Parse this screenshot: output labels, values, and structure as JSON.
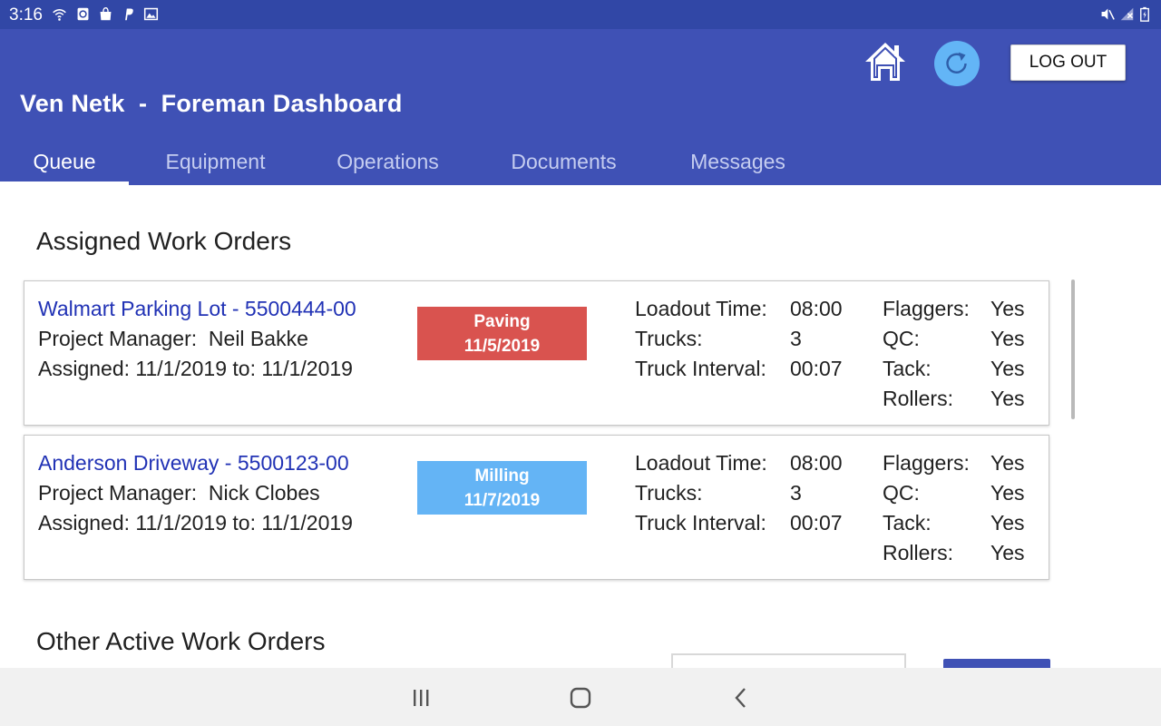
{
  "status_bar": {
    "time": "3:16",
    "left_icons": [
      "wifi-icon",
      "notification-app-icon",
      "shopping-bag-icon",
      "paypal-icon",
      "image-icon"
    ],
    "right_icons": [
      "mute-icon",
      "no-signal-icon",
      "battery-charging-icon"
    ]
  },
  "header": {
    "title": "Ven Netk  -  Foreman Dashboard",
    "logout_label": "LOG OUT"
  },
  "tabs": [
    {
      "label": "Queue",
      "active": true
    },
    {
      "label": "Equipment",
      "active": false
    },
    {
      "label": "Operations",
      "active": false
    },
    {
      "label": "Documents",
      "active": false
    },
    {
      "label": "Messages",
      "active": false
    }
  ],
  "assigned": {
    "title": "Assigned Work Orders",
    "orders": [
      {
        "name": "Walmart Parking Lot - 5500444-00",
        "pm_label": "Project Manager:",
        "pm_name": "Neil Bakke",
        "assigned_text": "Assigned: 11/1/2019 to: 11/1/2019",
        "badge_type": "Paving",
        "badge_date": "11/5/2019",
        "badge_color": "#d9534f",
        "loadout_label": "Loadout Time:",
        "loadout_value": "08:00",
        "trucks_label": "Trucks:",
        "trucks_value": "3",
        "interval_label": "Truck Interval:",
        "interval_value": "00:07",
        "flaggers_label": "Flaggers:",
        "flaggers_value": "Yes",
        "qc_label": "QC:",
        "qc_value": "Yes",
        "tack_label": "Tack:",
        "tack_value": "Yes",
        "rollers_label": "Rollers:",
        "rollers_value": "Yes"
      },
      {
        "name": "Anderson Driveway - 5500123-00",
        "pm_label": "Project Manager:",
        "pm_name": "Nick Clobes",
        "assigned_text": "Assigned: 11/1/2019 to: 11/1/2019",
        "badge_type": "Milling",
        "badge_date": "11/7/2019",
        "badge_color": "#64b4f5",
        "loadout_label": "Loadout Time:",
        "loadout_value": "08:00",
        "trucks_label": "Trucks:",
        "trucks_value": "3",
        "interval_label": "Truck Interval:",
        "interval_value": "00:07",
        "flaggers_label": "Flaggers:",
        "flaggers_value": "Yes",
        "qc_label": "QC:",
        "qc_value": "Yes",
        "tack_label": "Tack:",
        "tack_value": "Yes",
        "rollers_label": "Rollers:",
        "rollers_value": "Yes"
      }
    ]
  },
  "other": {
    "title": "Other Active Work Orders"
  },
  "nav_bar": {
    "buttons": [
      "recent-apps-icon",
      "home-circle-icon",
      "back-icon"
    ]
  },
  "colors": {
    "app_bar": "#3f51b5",
    "status_bar": "#3147a6",
    "link": "#2132b5",
    "refresh_button": "#63b5f6"
  }
}
